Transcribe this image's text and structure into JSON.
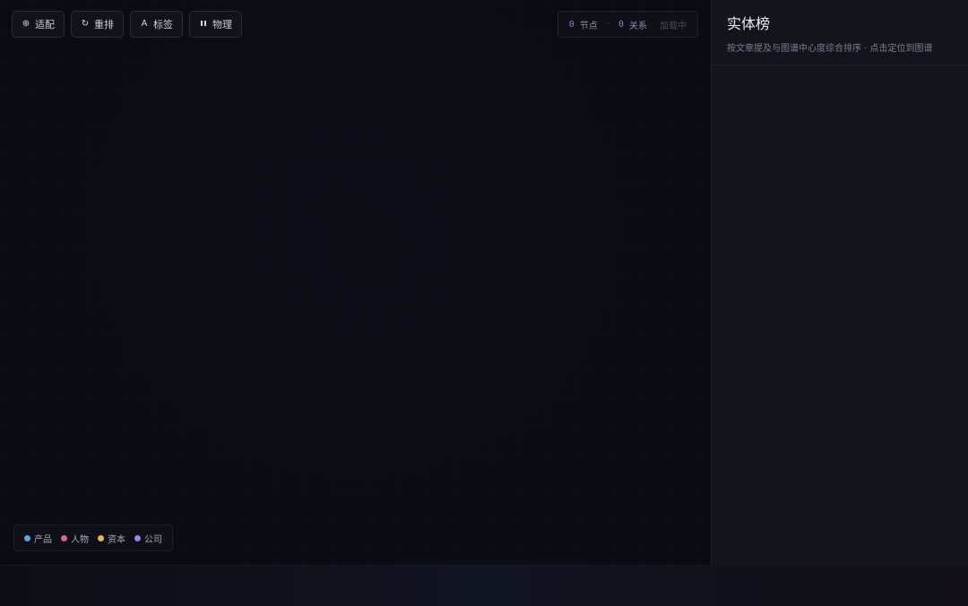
{
  "toolbar": {
    "fit": {
      "icon": "crosshair-icon",
      "label": "适配"
    },
    "relayout": {
      "icon": "refresh-icon",
      "label": "重排"
    },
    "labels": {
      "icon": "text-icon",
      "label": "标签"
    },
    "physics": {
      "icon": "pause-icon",
      "label": "物理"
    }
  },
  "stats": {
    "nodes_count": "0",
    "nodes_label": "节点",
    "separator": "·",
    "edges_count": "0",
    "edges_label": "关系",
    "status": "加载中"
  },
  "legend": {
    "items": [
      {
        "label": "产品",
        "color": "#5aa6e6"
      },
      {
        "label": "人物",
        "color": "#e0609a"
      },
      {
        "label": "资本",
        "color": "#e2b64c"
      },
      {
        "label": "公司",
        "color": "#9a86e8"
      }
    ]
  },
  "side_panel": {
    "title": "实体榜",
    "subtitle": "按文章提及与图谱中心度综合排序 · 点击定位到图谱"
  }
}
